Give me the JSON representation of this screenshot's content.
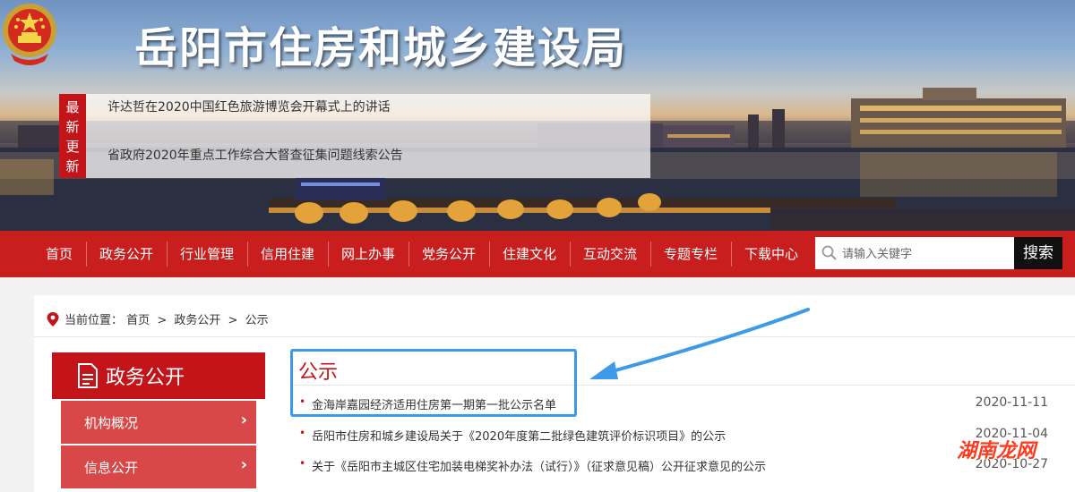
{
  "header": {
    "site_title": "岳阳市住房和城乡建设局"
  },
  "latest_news": {
    "tag": [
      "最",
      "新",
      "更",
      "新"
    ],
    "items": [
      "许达哲在2020中国红色旅游博览会开幕式上的讲话",
      "省政府2020年重点工作综合大督查征集问题线索公告"
    ]
  },
  "nav": {
    "items": [
      "首页",
      "政务公开",
      "行业管理",
      "信用住建",
      "网上办事",
      "党务公开",
      "住建文化",
      "互动交流",
      "专题专栏",
      "下载中心"
    ],
    "search_placeholder": "请输入关键字",
    "search_button": "搜索"
  },
  "breadcrumb": {
    "prefix": "当前位置：",
    "items": [
      "首页",
      "政务公开",
      "公示"
    ],
    "separator": ">"
  },
  "sidebar": {
    "title": "政务公开",
    "items": [
      {
        "label": "机构概况"
      },
      {
        "label": "信息公开"
      }
    ],
    "chevron": "›"
  },
  "main": {
    "title": "公示",
    "rows": [
      {
        "title": "金海岸嘉园经济适用住房第一期第一批公示名单",
        "date": "2020-11-11"
      },
      {
        "title": "岳阳市住房和城乡建设局关于《2020年度第二批绿色建筑评价标识项目》的公示",
        "date": "2020-11-04"
      },
      {
        "title": "关于《岳阳市主城区住宅加装电梯奖补办法（试行）》（征求意见稿）公开征求意见的公示",
        "date": "2020-10-27"
      }
    ]
  },
  "watermark": "湖南龙网",
  "colors": {
    "brand_red": "#c81e1e",
    "accent_red": "#c3141a",
    "highlight_blue": "#3d9ae8"
  }
}
